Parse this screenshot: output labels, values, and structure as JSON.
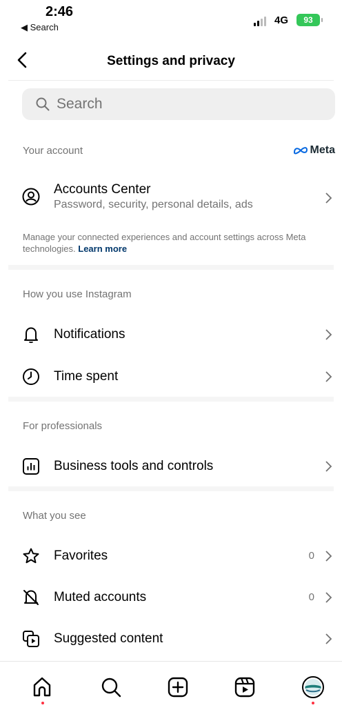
{
  "status_bar": {
    "time": "2:46",
    "back_app": "◀ Search",
    "network": "4G",
    "battery": "93"
  },
  "header": {
    "title": "Settings and privacy"
  },
  "search": {
    "placeholder": "Search"
  },
  "sections": {
    "your_account": {
      "label": "Your account",
      "brand": "Meta",
      "accounts_center": {
        "title": "Accounts Center",
        "subtitle": "Password, security, personal details, ads"
      },
      "manage_text": "Manage your connected experiences and account settings across Meta technologies.",
      "learn_more": "Learn more"
    },
    "how_you_use": {
      "label": "How you use Instagram",
      "items": [
        {
          "label": "Notifications"
        },
        {
          "label": "Time spent"
        }
      ]
    },
    "for_professionals": {
      "label": "For professionals",
      "items": [
        {
          "label": "Business tools and controls"
        }
      ]
    },
    "what_you_see": {
      "label": "What you see",
      "items": [
        {
          "label": "Favorites",
          "count": "0"
        },
        {
          "label": "Muted accounts",
          "count": "0"
        },
        {
          "label": "Suggested content"
        }
      ]
    }
  },
  "tab_bar": {
    "tabs": [
      {
        "icon": "home-icon"
      },
      {
        "icon": "search-icon"
      },
      {
        "icon": "create-icon"
      },
      {
        "icon": "reels-icon"
      },
      {
        "icon": "profile-avatar"
      }
    ]
  },
  "colors": {
    "secondary_text": "#737373",
    "link": "#00376b",
    "notification_dot": "#ff3040",
    "battery": "#34c759"
  }
}
